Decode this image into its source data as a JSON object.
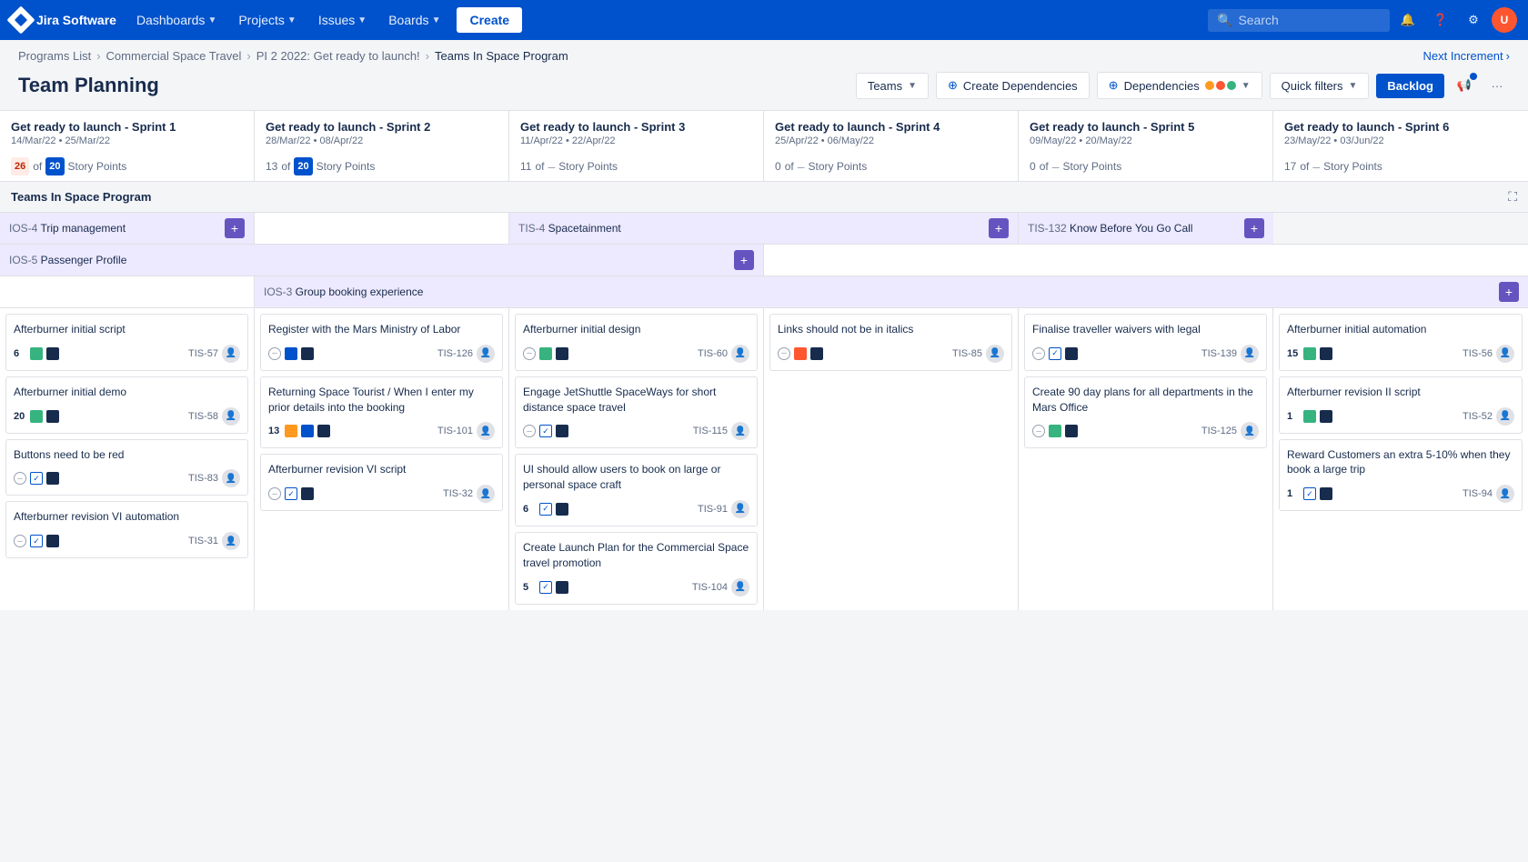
{
  "app": {
    "name": "Jira Software"
  },
  "nav": {
    "dashboards": "Dashboards",
    "projects": "Projects",
    "issues": "Issues",
    "boards": "Boards",
    "create": "Create",
    "search_placeholder": "Search"
  },
  "breadcrumb": {
    "items": [
      "Programs List",
      "Commercial Space Travel",
      "PI 2 2022: Get ready to launch!",
      "Teams In Space Program"
    ],
    "next_increment": "Next Increment"
  },
  "page": {
    "title": "Team Planning",
    "teams_btn": "Teams",
    "create_dep_btn": "Create Dependencies",
    "dependencies_btn": "Dependencies",
    "quick_filters_btn": "Quick filters",
    "backlog_btn": "Backlog"
  },
  "sprints": [
    {
      "name": "Get ready to launch - Sprint 1",
      "dates": "14/Mar/22 • 25/Mar/22",
      "points_current": "26",
      "points_target": "20",
      "points_label": "Story Points",
      "over": true
    },
    {
      "name": "Get ready to launch - Sprint 2",
      "dates": "28/Mar/22 • 08/Apr/22",
      "points_current": "13",
      "points_target": "20",
      "points_label": "Story Points",
      "over": false
    },
    {
      "name": "Get ready to launch - Sprint 3",
      "dates": "11/Apr/22 • 22/Apr/22",
      "points_current": "11",
      "points_target": null,
      "points_label": "Story Points",
      "over": false
    },
    {
      "name": "Get ready to launch - Sprint 4",
      "dates": "25/Apr/22 • 06/May/22",
      "points_current": "0",
      "points_target": null,
      "points_label": "Story Points",
      "over": false
    },
    {
      "name": "Get ready to launch - Sprint 5",
      "dates": "09/May/22 • 20/May/22",
      "points_current": "0",
      "points_target": null,
      "points_label": "Story Points",
      "over": false
    },
    {
      "name": "Get ready to launch - Sprint 6",
      "dates": "23/May/22 • 03/Jun/22",
      "points_current": "17",
      "points_target": null,
      "points_label": "Story Points",
      "over": false
    }
  ],
  "team_section": "Teams In Space Program",
  "epics": {
    "row1": [
      {
        "id": "IOS-4",
        "title": "Trip management",
        "empty": false,
        "span": 1
      },
      {
        "empty": true
      },
      {
        "id": "TIS-4",
        "title": "Spacetainment",
        "empty": false,
        "span": 2
      },
      {
        "id": "TIS-132",
        "title": "Know Before You Go Call",
        "empty": false,
        "span": 1
      }
    ],
    "row2": [
      {
        "id": "IOS-5",
        "title": "Passenger Profile",
        "empty": false,
        "span": 3
      },
      {
        "empty": true,
        "span": 3
      }
    ],
    "row3": [
      {
        "empty": true
      },
      {
        "id": "IOS-3",
        "title": "Group booking experience",
        "empty": false,
        "span": 5
      }
    ]
  },
  "columns": [
    {
      "cards": [
        {
          "title": "Afterburner initial script",
          "points": "6",
          "type1": "green",
          "type2": "dark",
          "id": "TIS-57",
          "priority": "medium"
        },
        {
          "title": "Afterburner initial demo",
          "points": "20",
          "type1": "green",
          "type2": "dark",
          "id": "TIS-58",
          "priority": "medium"
        },
        {
          "title": "Buttons need to be red",
          "points": "",
          "type1": "check",
          "type2": "dark",
          "id": "TIS-83",
          "priority": "dash"
        },
        {
          "title": "Afterburner revision VI automation",
          "points": "",
          "type1": "check",
          "type2": "dark",
          "id": "TIS-31",
          "priority": "dash"
        }
      ]
    },
    {
      "cards": [
        {
          "title": "Register with the Mars Ministry of Labor",
          "points": "",
          "type1": "dash",
          "type2": "blue",
          "type3": "dark",
          "id": "TIS-126",
          "priority": "dash"
        },
        {
          "title": "Returning Space Tourist / When I enter my prior details into the booking",
          "points": "13",
          "type1": "orange",
          "type2": "blue",
          "type3": "dark",
          "id": "TIS-101",
          "priority": "high"
        },
        {
          "title": "Afterburner revision VI script",
          "points": "",
          "type1": "dash",
          "type2": "check",
          "type3": "dark",
          "id": "TIS-32",
          "priority": "dash"
        }
      ]
    },
    {
      "cards": [
        {
          "title": "Afterburner initial design",
          "points": "",
          "type1": "dash",
          "type2": "green",
          "type3": "dark",
          "id": "TIS-60",
          "priority": "dash"
        },
        {
          "title": "Engage JetShuttle SpaceWays for short distance space travel",
          "points": "",
          "type1": "dash",
          "type2": "check",
          "type3": "dark",
          "id": "TIS-115",
          "priority": "dash"
        },
        {
          "title": "UI should allow users to book on large or personal space craft",
          "points": "6",
          "type1": "check",
          "type2": "dark",
          "id": "TIS-91",
          "priority": "check"
        },
        {
          "title": "Create Launch Plan for the Commercial Space travel promotion",
          "points": "5",
          "type1": "check",
          "type2": "dark",
          "id": "TIS-104",
          "priority": "check"
        }
      ]
    },
    {
      "cards": [
        {
          "title": "Links should not be in italics",
          "points": "",
          "type1": "dash",
          "type2": "red",
          "type3": "dark",
          "id": "TIS-85",
          "priority": "dash"
        }
      ]
    },
    {
      "cards": [
        {
          "title": "Finalise traveller waivers with legal",
          "points": "",
          "type1": "dash",
          "type2": "check",
          "type3": "dark",
          "id": "TIS-139",
          "priority": "dash"
        },
        {
          "title": "Create 90 day plans for all departments in the Mars Office",
          "points": "",
          "type1": "dash",
          "type2": "green",
          "type3": "dark",
          "id": "TIS-125",
          "priority": "dash"
        }
      ]
    },
    {
      "cards": [
        {
          "title": "Afterburner initial automation",
          "points": "15",
          "type1": "green",
          "type2": "dark",
          "id": "TIS-56",
          "priority": "medium"
        },
        {
          "title": "Afterburner revision II script",
          "points": "1",
          "type1": "green",
          "type2": "dark",
          "id": "TIS-52",
          "priority": "medium"
        },
        {
          "title": "Reward Customers an extra 5-10% when they book a large trip",
          "points": "1",
          "type1": "check",
          "type2": "dark",
          "id": "TIS-94",
          "priority": "check"
        }
      ]
    }
  ]
}
